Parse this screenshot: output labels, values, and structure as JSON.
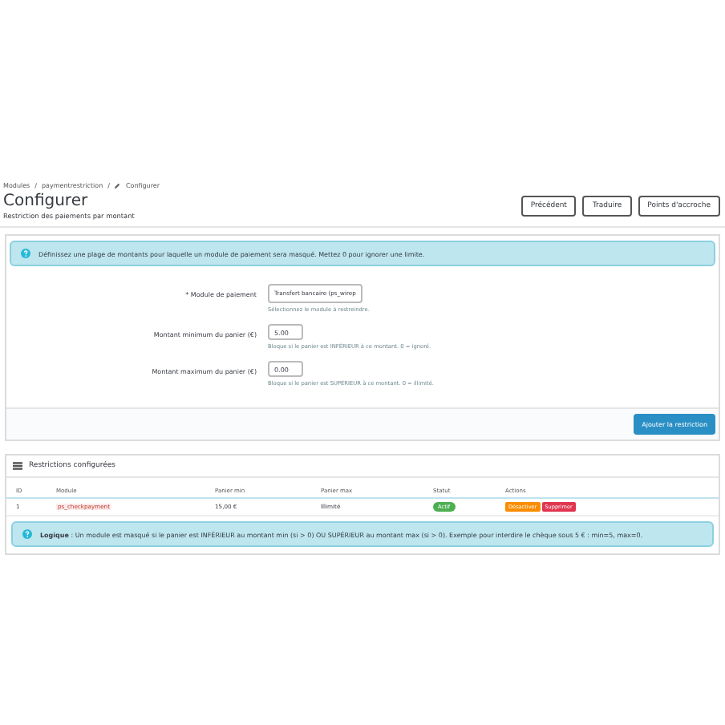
{
  "breadcrumb": [
    "Modules",
    "paymentrestriction",
    "Configurer"
  ],
  "breadcrumb_separator": "/",
  "title": "Configurer",
  "subtitle": "Restriction des paiements par montant",
  "header_buttons": [
    "Précédent",
    "Traduire",
    "Points d'accroche"
  ],
  "info": "Définissez une plage de montants pour laquelle un module de paiement sera masqué. Mettez 0 pour ignorer une limite.",
  "form": {
    "fields": [
      {
        "kind": "select",
        "label": "* Module de paiement",
        "value": "Transfert bancaire (ps_wirep",
        "hint": "Sélectionnez le module à restreindre."
      },
      {
        "kind": "input",
        "label": "Montant minimum du panier (€)",
        "value": "5.00",
        "hint": "Bloque si le panier est INFÉRIEUR à ce montant. 0 = ignoré."
      },
      {
        "kind": "input",
        "label": "Montant maximum du panier (€)",
        "value": "0.00",
        "hint": "Bloque si le panier est SUPÉRIEUR à ce montant. 0 = illimité."
      }
    ],
    "submit": "Ajouter la restriction"
  },
  "table": {
    "title": "Restrictions configurées",
    "columns": [
      "ID",
      "Module",
      "Panier min",
      "Panier max",
      "Statut",
      "Actions"
    ],
    "rows": [
      {
        "id": "1",
        "module": "ps_checkpayment",
        "min": "15,00 €",
        "max": "Illimité",
        "status": "Actif",
        "active": true,
        "actions": [
          "Désactiver",
          "Supprimer"
        ]
      }
    ]
  },
  "logic": "**Logique** : Un module est masqué si le panier est INFÉRIEUR au montant min (si > 0) OU SUPÉRIEUR au montant max (si > 0). Exemple pour interdire le chèque sous 5 € : min=5, max=0."
}
